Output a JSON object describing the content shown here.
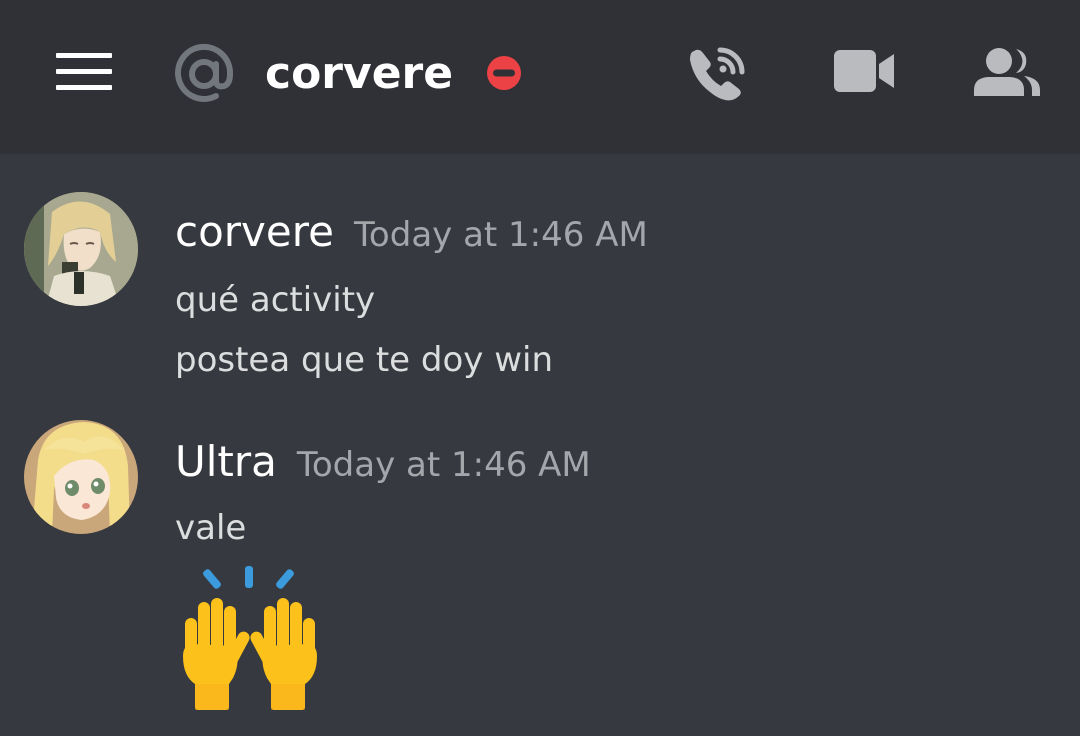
{
  "header": {
    "channel_name": "corvere",
    "status": "do-not-disturb",
    "icons": [
      "hamburger-menu-icon",
      "at-icon",
      "dnd-status-icon",
      "call-icon",
      "video-call-icon",
      "members-icon"
    ]
  },
  "colors": {
    "header_bg": "#2f3136",
    "chat_bg": "#36393f",
    "dnd_red": "#ed4245",
    "icon_gray": "#b9bbbe",
    "timestamp_gray": "#a3a6aa"
  },
  "messages": [
    {
      "username": "corvere",
      "timestamp": "Today at 1:46 AM",
      "lines": [
        "qué activity",
        "postea que te doy win"
      ]
    },
    {
      "username": "Ultra",
      "timestamp": "Today at 1:46 AM",
      "lines": [
        "vale"
      ],
      "emoji": "raising-hands-emoji"
    }
  ]
}
